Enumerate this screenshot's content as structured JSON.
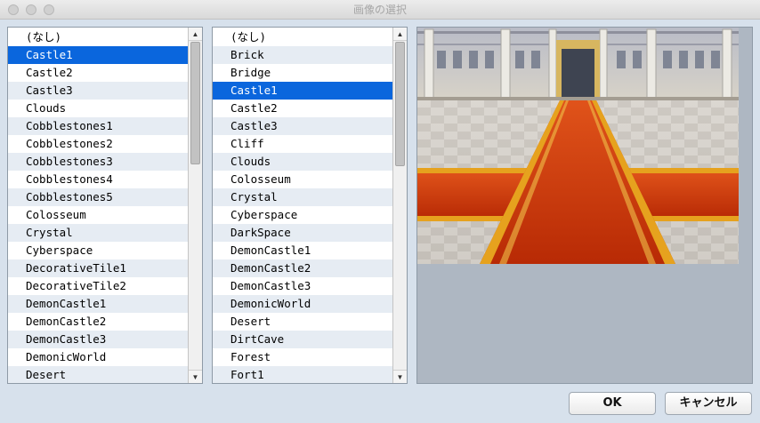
{
  "window": {
    "title": "画像の選択"
  },
  "left_list": {
    "selected_index": 1,
    "items": [
      "(なし)",
      "Castle1",
      "Castle2",
      "Castle3",
      "Clouds",
      "Cobblestones1",
      "Cobblestones2",
      "Cobblestones3",
      "Cobblestones4",
      "Cobblestones5",
      "Colosseum",
      "Crystal",
      "Cyberspace",
      "DecorativeTile1",
      "DecorativeTile2",
      "DemonCastle1",
      "DemonCastle2",
      "DemonCastle3",
      "DemonicWorld",
      "Desert"
    ]
  },
  "right_list": {
    "selected_index": 3,
    "items": [
      "(なし)",
      "Brick",
      "Bridge",
      "Castle1",
      "Castle2",
      "Castle3",
      "Cliff",
      "Clouds",
      "Colosseum",
      "Crystal",
      "Cyberspace",
      "DarkSpace",
      "DemonCastle1",
      "DemonCastle2",
      "DemonCastle3",
      "DemonicWorld",
      "Desert",
      "DirtCave",
      "Forest",
      "Fort1"
    ]
  },
  "scroll_arrows": {
    "up": "▲",
    "down": "▼"
  },
  "buttons": {
    "ok": "OK",
    "cancel": "キャンセル"
  },
  "colors": {
    "selection": "#0a66dd",
    "row_alt": "#e6ecf3",
    "preview_bg": "#aeb7c2",
    "carpet": "#d13a0a",
    "carpet_trim": "#e6a21e"
  }
}
